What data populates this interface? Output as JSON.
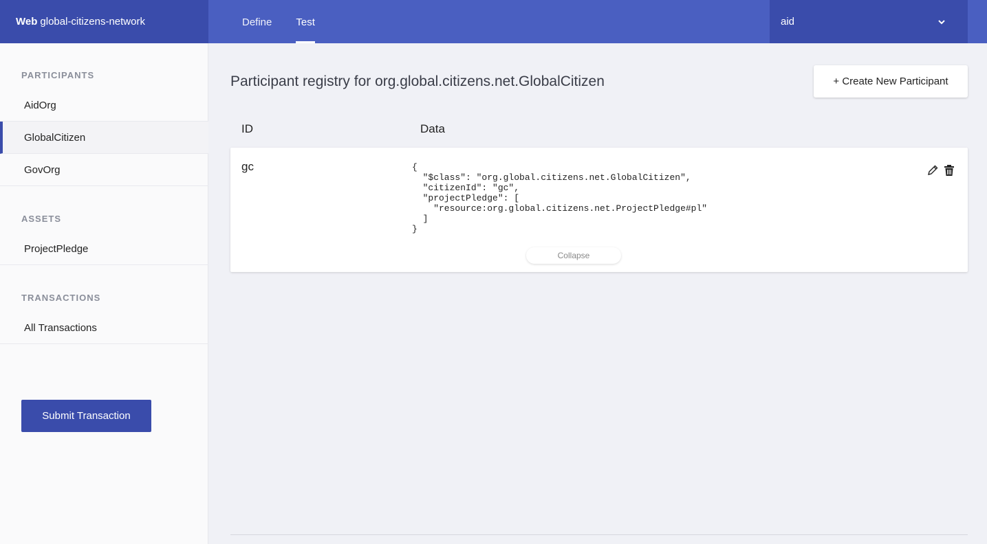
{
  "header": {
    "brand_bold": "Web",
    "brand_name": "global-citizens-network",
    "tabs": [
      {
        "label": "Define"
      },
      {
        "label": "Test"
      }
    ],
    "identity": "aid"
  },
  "sidebar": {
    "participants_title": "PARTICIPANTS",
    "participants": [
      {
        "label": "AidOrg"
      },
      {
        "label": "GlobalCitizen"
      },
      {
        "label": "GovOrg"
      }
    ],
    "assets_title": "ASSETS",
    "assets": [
      {
        "label": "ProjectPledge"
      }
    ],
    "transactions_title": "TRANSACTIONS",
    "transactions": [
      {
        "label": "All Transactions"
      }
    ],
    "submit_label": "Submit Transaction"
  },
  "main": {
    "title": "Participant registry for org.global.citizens.net.GlobalCitizen",
    "create_label": "+ Create New Participant",
    "col_id": "ID",
    "col_data": "Data",
    "records": [
      {
        "id": "gc",
        "data": "{\n  \"$class\": \"org.global.citizens.net.GlobalCitizen\",\n  \"citizenId\": \"gc\",\n  \"projectPledge\": [\n    \"resource:org.global.citizens.net.ProjectPledge#pl\"\n  ]\n}",
        "collapse_label": "Collapse"
      }
    ]
  },
  "colors": {
    "topbar": "#4a5fc1",
    "topbar_dark": "#3a4cab",
    "background": "#f0f1f6"
  },
  "icons": {
    "identity_toggle": "chevron-down-icon",
    "edit": "pencil-icon",
    "delete": "trash-icon"
  }
}
